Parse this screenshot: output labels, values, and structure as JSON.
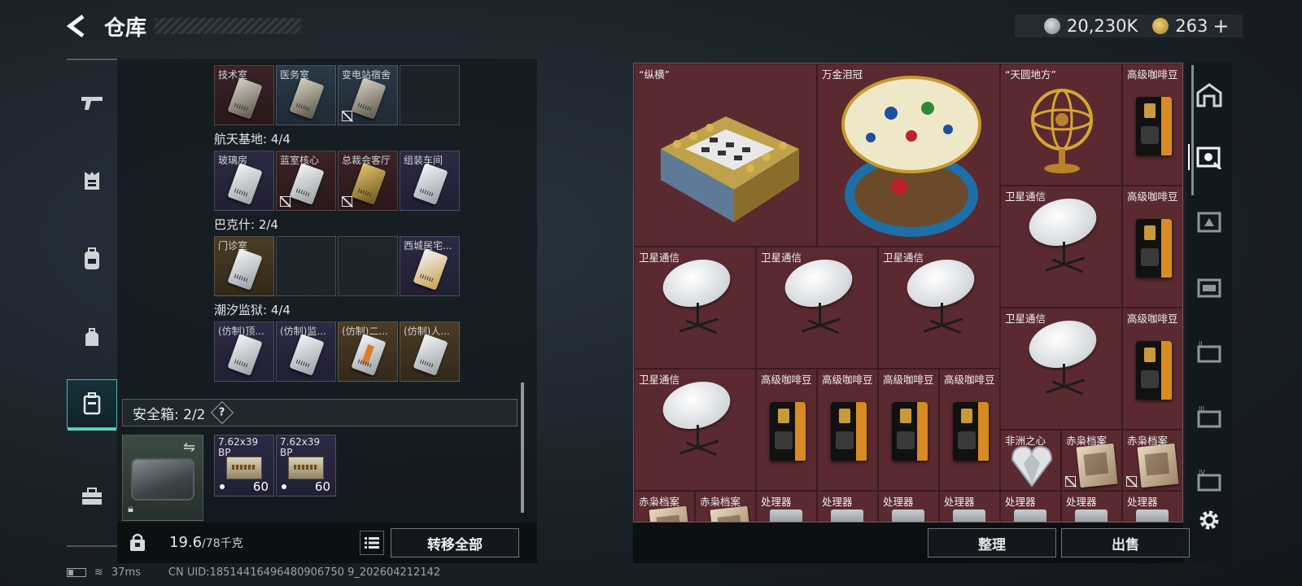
{
  "header": {
    "title": "仓库"
  },
  "currency": {
    "silver": "20,230K",
    "gold": "263",
    "plus": "+"
  },
  "left_nav": [
    {
      "icon": "gun-icon"
    },
    {
      "icon": "armor-icon"
    },
    {
      "icon": "backpack-icon"
    },
    {
      "icon": "bag-icon"
    },
    {
      "icon": "secure-case-icon",
      "active": true
    },
    {
      "icon": "toolbox-icon"
    }
  ],
  "keycards": {
    "row0": [
      "技术室",
      "医务室",
      "变电站宿舍",
      ""
    ],
    "group1": "航天基地: 4/4",
    "row1": [
      "玻璃房",
      "蓝室核心",
      "总裁会客厅",
      "组装车间"
    ],
    "group2": "巴克什: 2/4",
    "row2": [
      "门诊室",
      "",
      "",
      "西城居宅..."
    ],
    "group3": "潮汐监狱: 4/4",
    "row3": [
      "(仿制)顶...",
      "(仿制)监...",
      "(仿制)二...",
      "(仿制)人..."
    ]
  },
  "safebox": {
    "label": "安全箱: 2/2",
    "help": "?",
    "ammo": [
      {
        "name": "7.62x39 BP",
        "count": "60"
      },
      {
        "name": "7.62x39 BP",
        "count": "60"
      }
    ]
  },
  "bottom_left": {
    "weight": "19.6",
    "weight_unit": "/78千克",
    "transfer_all": "转移全部"
  },
  "status": {
    "ping": "37ms",
    "uid": "CN UID:18514416496480906750 9_202604212142"
  },
  "grid_items": {
    "chess": "“纵横”",
    "crown": "万金泪冠",
    "armillary": "“天圆地方”",
    "coffee": "高级咖啡豆",
    "satellite": "卫星通信",
    "heart": "非洲之心",
    "archive": "赤枭档案",
    "processor": "处理器"
  },
  "bottom_right": {
    "organize": "整理",
    "sell": "出售"
  }
}
